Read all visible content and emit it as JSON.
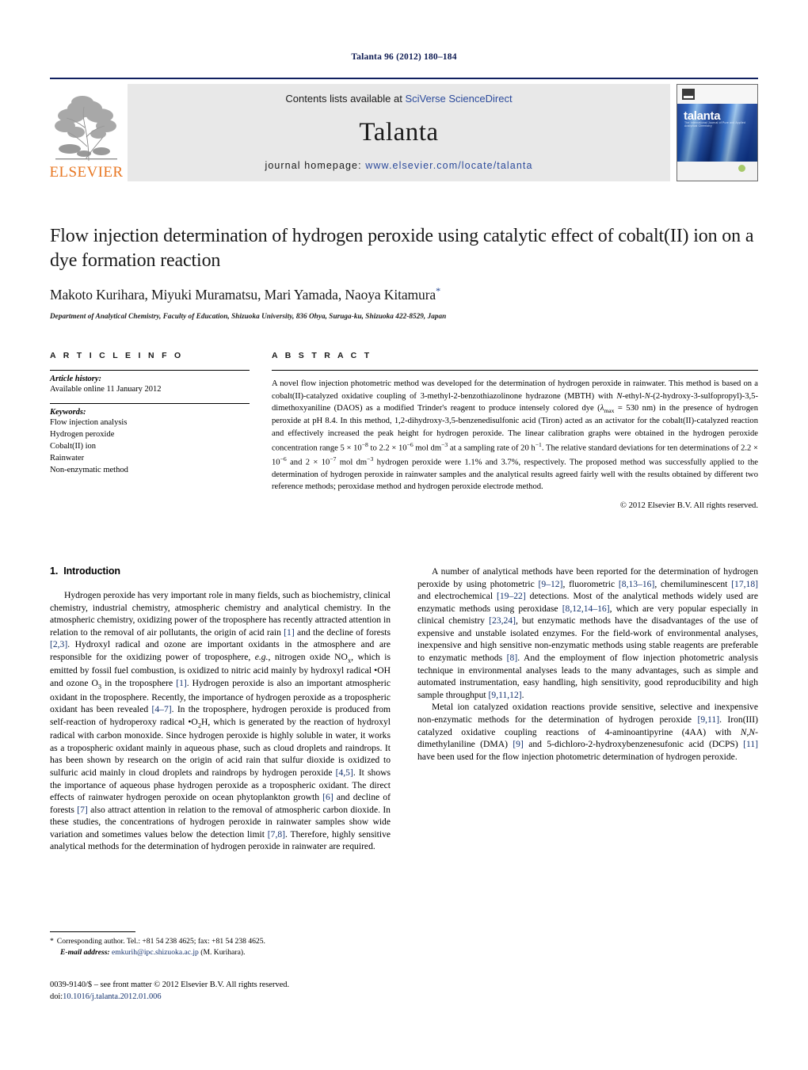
{
  "running_head": "Talanta 96 (2012) 180–184",
  "masthead": {
    "contents_prefix": "Contents lists available at ",
    "contents_link": "SciVerse ScienceDirect",
    "journal_title": "Talanta",
    "homepage_prefix": "journal homepage: ",
    "homepage_url": "www.elsevier.com/locate/talanta",
    "publisher": "ELSEVIER",
    "cover_title": "talanta",
    "cover_subtitle": "The International Journal of Pure and Applied Analytical Chemistry"
  },
  "title_block": {
    "title": "Flow injection determination of hydrogen peroxide using catalytic effect of cobalt(II) ion on a dye formation reaction",
    "authors": "Makoto Kurihara, Miyuki Muramatsu, Mari Yamada, Naoya Kitamura",
    "corresponding_marker": "*",
    "affiliation": "Department of Analytical Chemistry, Faculty of Education, Shizuoka University, 836 Ohya, Suruga-ku, Shizuoka 422-8529, Japan"
  },
  "article_info": {
    "heading": "ARTICLE INFO",
    "history_label": "Article history:",
    "history_lines": [
      "Available online 11 January 2012"
    ],
    "keywords_label": "Keywords:",
    "keywords": [
      "Flow injection analysis",
      "Hydrogen peroxide",
      "Cobalt(II) ion",
      "Rainwater",
      "Non-enzymatic method"
    ]
  },
  "abstract": {
    "heading": "ABSTRACT",
    "text": "A novel flow injection photometric method was developed for the determination of hydrogen peroxide in rainwater. This method is based on a cobalt(II)-catalyzed oxidative coupling of 3-methyl-2-benzothiazolinone hydrazone (MBTH) with N-ethyl-N-(2-hydroxy-3-sulfopropyl)-3,5-dimethoxyaniline (DAOS) as a modified Trinder's reagent to produce intensely colored dye (λmax = 530 nm) in the presence of hydrogen peroxide at pH 8.4. In this method, 1,2-dihydroxy-3,5-benzenedisulfonic acid (Tiron) acted as an activator for the cobalt(II)-catalyzed reaction and effectively increased the peak height for hydrogen peroxide. The linear calibration graphs were obtained in the hydrogen peroxide concentration range 5 × 10−8 to 2.2 × 10−6 mol dm−3 at a sampling rate of 20 h−1. The relative standard deviations for ten determinations of 2.2 × 10−6 and 2 × 10−7 mol dm−3 hydrogen peroxide were 1.1% and 3.7%, respectively. The proposed method was successfully applied to the determination of hydrogen peroxide in rainwater samples and the analytical results agreed fairly well with the results obtained by different two reference methods; peroxidase method and hydrogen peroxide electrode method.",
    "copyright": "© 2012 Elsevier B.V. All rights reserved."
  },
  "introduction": {
    "number": "1.",
    "heading": "Introduction",
    "paragraph_1": "Hydrogen peroxide has very important role in many fields, such as biochemistry, clinical chemistry, industrial chemistry, atmospheric chemistry and analytical chemistry. In the atmospheric chemistry, oxidizing power of the troposphere has recently attracted attention in relation to the removal of air pollutants, the origin of acid rain [1] and the decline of forests [2,3]. Hydroxyl radical and ozone are important oxidants in the atmosphere and are responsible for the oxidizing power of troposphere, e.g., nitrogen oxide NOx, which is emitted by fossil fuel combustion, is oxidized to nitric acid mainly by hydroxyl radical •OH and ozone O3 in the troposphere [1]. Hydrogen peroxide is also an important atmospheric oxidant in the troposphere. Recently, the importance of hydrogen peroxide as a tropospheric oxidant has been revealed [4–7]. In the troposphere, hydrogen peroxide is produced from self-reaction of hydroperoxy radical •O2H, which is generated by the reaction of hydroxyl radical with carbon monoxide. Since hydrogen peroxide is highly soluble in water, it works as a tropospheric oxidant mainly in aqueous phase, such as cloud droplets and raindrops. It has been shown by research on the origin of acid rain that sulfur dioxide is oxidized to sulfuric acid mainly in cloud droplets and raindrops by hydrogen peroxide [4,5]. It shows the importance of aqueous phase hydrogen peroxide as a tropospheric oxidant. The direct effects of rainwater hydrogen peroxide on ocean phytoplankton growth [6] and decline of forests [7] also attract attention in relation to the removal of atmospheric carbon dioxide. In these studies, the concentrations of hydrogen peroxide in rainwater samples show wide variation and sometimes values below the detection limit [7,8]. Therefore, highly sensitive analytical methods for the determination of hydrogen peroxide in rainwater are required.",
    "paragraph_2": "A number of analytical methods have been reported for the determination of hydrogen peroxide by using photometric [9–12], fluorometric [8,13–16], chemiluminescent [17,18] and electrochemical [19–22] detections. Most of the analytical methods widely used are enzymatic methods using peroxidase [8,12,14–16], which are very popular especially in clinical chemistry [23,24], but enzymatic methods have the disadvantages of the use of expensive and unstable isolated enzymes. For the field-work of environmental analyses, inexpensive and high sensitive non-enzymatic methods using stable reagents are preferable to enzymatic methods [8]. And the employment of flow injection photometric analysis technique in environmental analyses leads to the many advantages, such as simple and automated instrumentation, easy handling, high sensitivity, good reproducibility and high sample throughput [9,11,12].",
    "paragraph_3": "Metal ion catalyzed oxidation reactions provide sensitive, selective and inexpensive non-enzymatic methods for the determination of hydrogen peroxide [9,11]. Iron(III) catalyzed oxidative coupling reactions of 4-aminoantipyrine (4AA) with N,N-dimethylaniline (DMA) [9] and 5-dichloro-2-hydroxybenzenesufonic acid (DCPS) [11] have been used for the flow injection photometric determination of hydrogen peroxide."
  },
  "footnotes": {
    "corresponding_star": "*",
    "corresponding_text": "Corresponding author. Tel.: +81 54 238 4625; fax: +81 54 238 4625.",
    "email_label": "E-mail address:",
    "email": "emkurih@ipc.shizuoka.ac.jp",
    "email_suffix": "(M. Kurihara).",
    "issn_line": "0039-9140/$ – see front matter © 2012 Elsevier B.V. All rights reserved.",
    "doi_label": "doi:",
    "doi": "10.1016/j.talanta.2012.01.006"
  },
  "colors": {
    "running_head": "#0d1a52",
    "elsevier_orange": "#E87722",
    "link_blue": "#2b4a9b",
    "reference_blue": "#14326e",
    "band_gray": "#e8e8e8"
  }
}
